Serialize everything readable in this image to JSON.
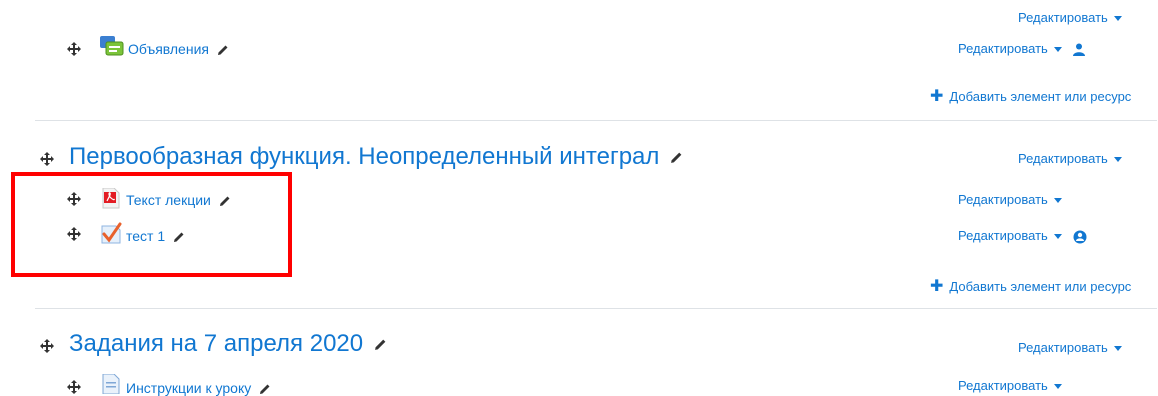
{
  "section0": {
    "edit_label_top": "Редактировать",
    "item": {
      "label": "Объявления",
      "edit_label": "Редактировать",
      "icon": "forum-icon"
    },
    "add_label": "Добавить элемент или ресурс"
  },
  "section1": {
    "title": "Первообразная функция. Неопределенный интеграл",
    "edit_label": "Редактировать",
    "items": [
      {
        "label": "Текст лекции",
        "edit_label": "Редактировать",
        "icon": "pdf-icon"
      },
      {
        "label": "тест 1",
        "edit_label": "Редактировать",
        "icon": "quiz-icon"
      }
    ],
    "add_label": "Добавить элемент или ресурс"
  },
  "section2": {
    "title": "Задания на 7 апреля 2020",
    "edit_label": "Редактировать",
    "items": [
      {
        "label": "Инструкции к уроку",
        "edit_label": "Редактировать",
        "icon": "page-icon"
      }
    ]
  },
  "colors": {
    "link": "#1177d1",
    "highlight": "#ff0000",
    "divider": "#dee2e6"
  }
}
